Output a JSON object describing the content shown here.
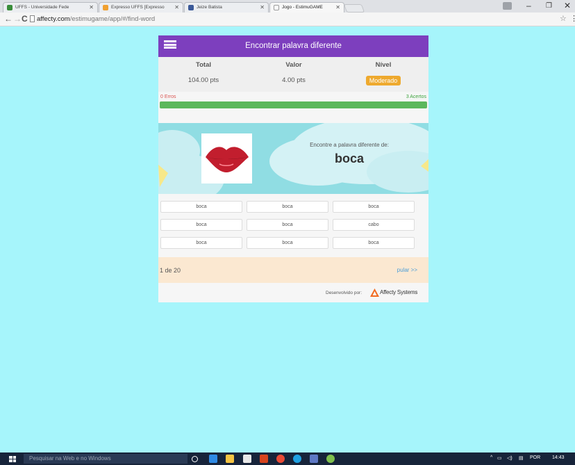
{
  "browser": {
    "tabs": [
      {
        "title": "UFFS - Universidade Fede",
        "favicon_color": "#3a8d3a"
      },
      {
        "title": "Expresso UFFS [Expresso",
        "favicon_color": "#f0a030"
      },
      {
        "title": "Jeize Batista",
        "favicon_color": "#3b5998"
      },
      {
        "title": "Jogo - EstimuGAME",
        "favicon_color": "#cccccc"
      }
    ],
    "url_host": "affecty.com",
    "url_path": "/estimugame/app/#/find-word"
  },
  "app": {
    "title": "Encontrar palavra diferente",
    "stats": {
      "headers": [
        "Total",
        "Valor",
        "Nível"
      ],
      "total": "104.00 pts",
      "value": "4.00 pts",
      "level": "Moderado"
    },
    "progress": {
      "errors_label": "0 Erros",
      "hits_label": "3 Acertos",
      "fraction": 1.0
    },
    "question": {
      "prompt": "Encontre a palavra diferente de:",
      "word": "boca",
      "image_icon": "lips-icon"
    },
    "options": [
      "boca",
      "boca",
      "boca",
      "boca",
      "boca",
      "cabo",
      "boca",
      "boca",
      "boca"
    ],
    "footer": {
      "counter": "1 de 20",
      "skip": "pular >>"
    },
    "credits": {
      "label": "Desenvolvido por:",
      "company": "Affecty Systems"
    }
  },
  "taskbar": {
    "search_placeholder": "Pesquisar na Web e no Windows",
    "language": "POR",
    "time": "14:43"
  },
  "colors": {
    "page_background": "#a6f5fb",
    "header_purple": "#7d3fbe",
    "badge_orange": "#eea92e",
    "progress_green": "#5cb85c",
    "error_red": "#d9534f",
    "footer_peach": "#fbe8d1",
    "sky_blue": "#90dde3"
  }
}
